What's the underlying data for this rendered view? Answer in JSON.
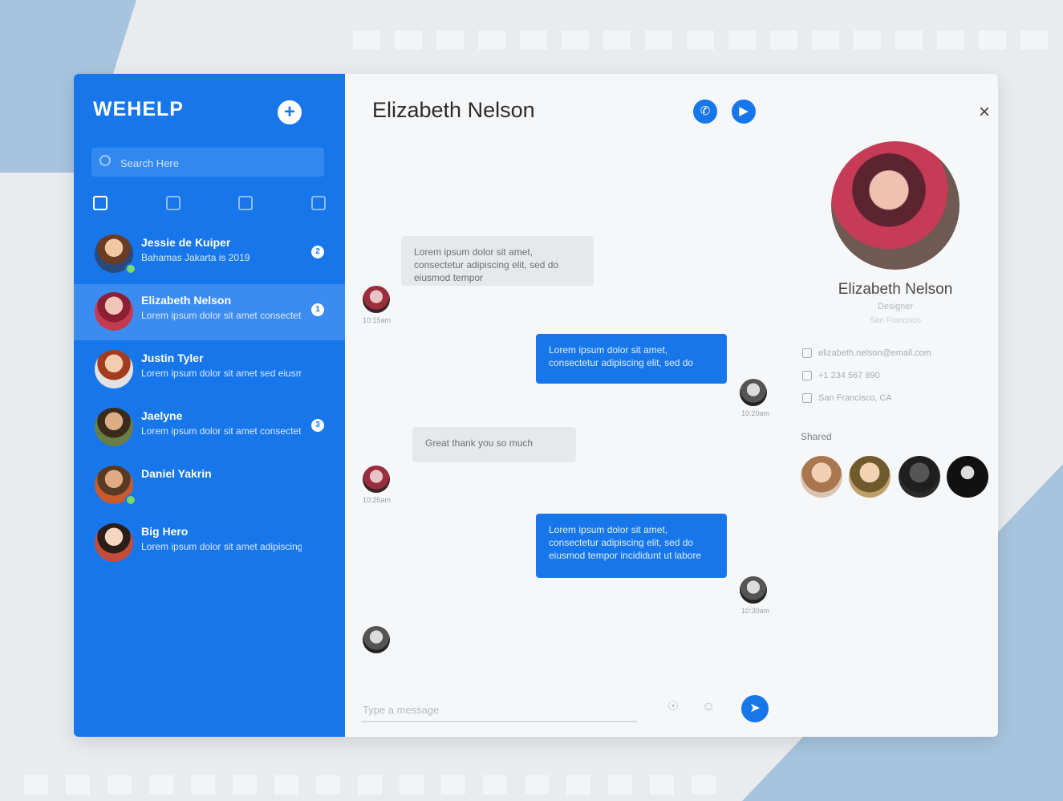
{
  "app": {
    "brand": "WEHELP",
    "new_button_label": "+",
    "search_placeholder": "Search Here"
  },
  "contacts": [
    {
      "name": "Jessie de Kuiper",
      "preview": "Bahamas Jakarta is 2019",
      "badge": "2",
      "selected": false
    },
    {
      "name": "Elizabeth Nelson",
      "preview": "Lorem ipsum dolor sit amet consectetur",
      "badge": "1",
      "selected": true
    },
    {
      "name": "Justin Tyler",
      "preview": "Lorem ipsum dolor sit amet sed eiusmod",
      "badge": "",
      "selected": false
    },
    {
      "name": "Jaelyne",
      "preview": "Lorem ipsum dolor sit amet consectetur",
      "badge": "3",
      "selected": false
    },
    {
      "name": "Daniel Yakrin",
      "preview": "",
      "badge": "",
      "selected": false
    },
    {
      "name": "Big Hero",
      "preview": "Lorem ipsum dolor sit amet adipiscing",
      "badge": "",
      "selected": false
    }
  ],
  "chat": {
    "title": "Elizabeth Nelson",
    "call_icon": "phone-icon",
    "video_icon": "video-icon",
    "close_label": "×",
    "messages": [
      {
        "dir": "in",
        "text": "Lorem ipsum dolor sit amet, consectetur adipiscing elit, sed do eiusmod tempor",
        "time": "10:15am"
      },
      {
        "dir": "out",
        "text": "Lorem ipsum dolor sit amet, consectetur adipiscing elit, sed do",
        "time": "10:20am"
      },
      {
        "dir": "in",
        "text": "Great thank you so much",
        "time": "10:25am"
      },
      {
        "dir": "out",
        "text": "Lorem ipsum dolor sit amet, consectetur adipiscing elit, sed do eiusmod tempor incididunt ut labore",
        "time": "10:30am"
      }
    ],
    "composer_placeholder": "Type a message",
    "send_icon": "send-icon"
  },
  "profile": {
    "name": "Elizabeth Nelson",
    "subtitle": "Designer",
    "location": "San Francisco",
    "info": [
      "elizabeth.nelson@email.com",
      "+1 234 567 890",
      "San Francisco, CA"
    ],
    "shared_label": "Shared"
  }
}
